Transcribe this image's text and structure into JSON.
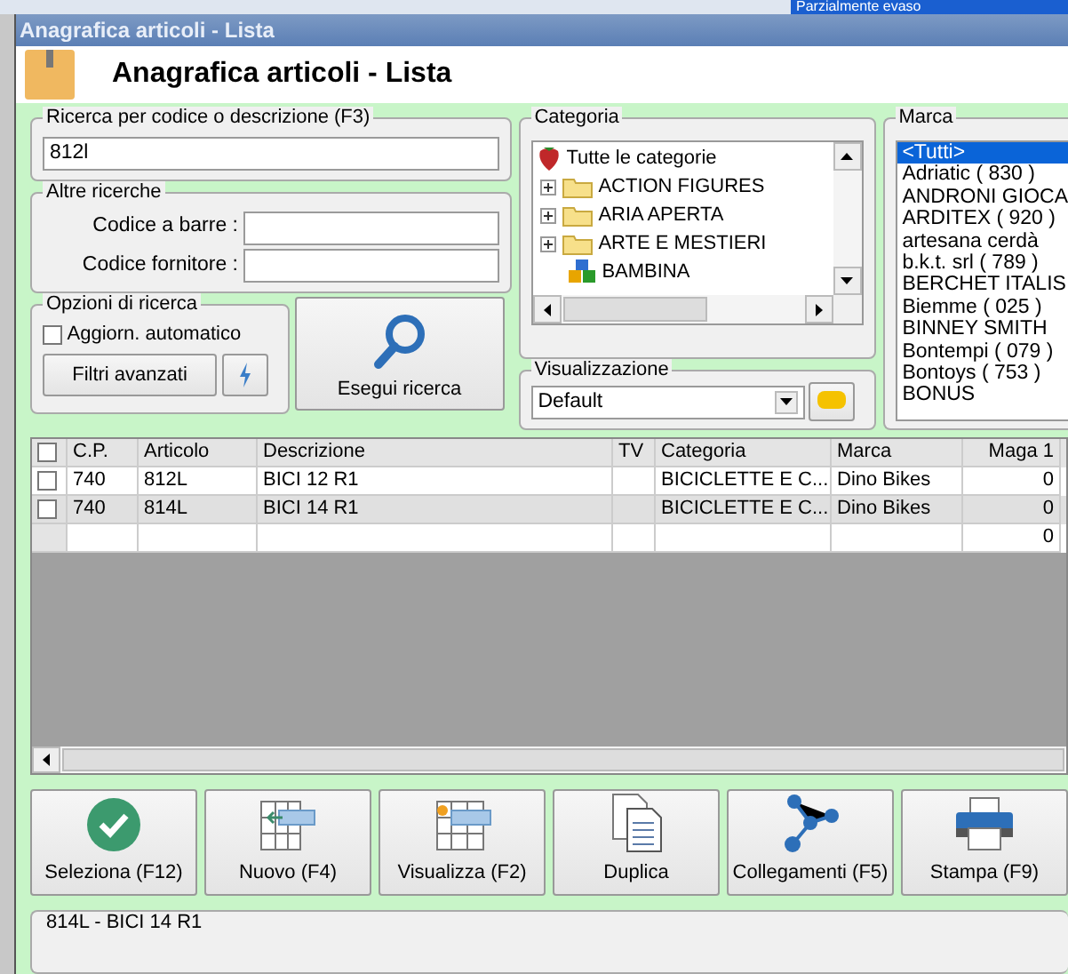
{
  "background_window": {
    "status_text": "Parzialmente evaso"
  },
  "window": {
    "title": "Anagrafica articoli  - Lista",
    "heading": "Anagrafica articoli  - Lista"
  },
  "search": {
    "label": "Ricerca per codice o descrizione (F3)",
    "value": "812l"
  },
  "other_searches": {
    "label": "Altre ricerche",
    "fields": [
      {
        "label": "Codice a barre :"
      },
      {
        "label": "Codice fornitore :"
      }
    ]
  },
  "options": {
    "label": "Opzioni di ricerca",
    "auto_update": {
      "label": "Aggiorn. automatico",
      "checked": false
    },
    "advanced_filters": "Filtri avanzati"
  },
  "search_button": "Esegui ricerca",
  "category": {
    "label": "Categoria",
    "items": [
      {
        "kind": "root",
        "label": "Tutte le categorie"
      },
      {
        "kind": "folder",
        "label": "ACTION FIGURES"
      },
      {
        "kind": "folder",
        "label": "ARIA APERTA"
      },
      {
        "kind": "folder",
        "label": "ARTE E MESTIERI"
      },
      {
        "kind": "blocks",
        "label": "BAMBINA"
      }
    ]
  },
  "view": {
    "label": "Visualizzazione",
    "value": "Default"
  },
  "brand": {
    "label": "Marca",
    "items": [
      {
        "label": "<Tutti>",
        "selected": true
      },
      {
        "label": "Adriatic ( 830 )",
        "selected": false
      },
      {
        "label": "ANDRONI GIOCA",
        "selected": false
      },
      {
        "label": "ARDITEX ( 920 )",
        "selected": false
      },
      {
        "label": "artesana cerdà",
        "selected": false
      },
      {
        "label": "b.k.t. srl ( 789 )",
        "selected": false
      },
      {
        "label": "BERCHET ITALIS",
        "selected": false
      },
      {
        "label": "Biemme ( 025 )",
        "selected": false
      },
      {
        "label": "BINNEY SMITH",
        "selected": false
      },
      {
        "label": "Bontempi ( 079 )",
        "selected": false
      },
      {
        "label": "Bontoys ( 753 )",
        "selected": false
      },
      {
        "label": "BONUS",
        "selected": false
      }
    ]
  },
  "table": {
    "select_all_checked": false,
    "columns": [
      "C.P.",
      "Articolo",
      "Descrizione",
      "TV",
      "Categoria",
      "Marca",
      "Maga 1"
    ],
    "rows": [
      {
        "checked": false,
        "selected": false,
        "cells": [
          "740",
          "812L",
          "BICI 12 R1",
          "",
          "BICICLETTE E C...",
          "Dino Bikes",
          "0"
        ]
      },
      {
        "checked": false,
        "selected": true,
        "cells": [
          "740",
          "814L",
          "BICI 14 R1",
          "",
          "BICICLETTE E C...",
          "Dino Bikes",
          "0"
        ]
      },
      {
        "kind": "new",
        "cells": [
          "",
          "",
          "",
          "",
          "",
          "",
          "0"
        ]
      }
    ]
  },
  "toolbar": [
    {
      "kind": "check",
      "label": "Seleziona (F12)"
    },
    {
      "kind": "new",
      "label": "Nuovo (F4)"
    },
    {
      "kind": "view",
      "label": "Visualizza (F2)"
    },
    {
      "kind": "copy",
      "label": "Duplica"
    },
    {
      "kind": "links",
      "label": "Collegamenti (F5)"
    },
    {
      "kind": "print",
      "label": "Stampa (F9)"
    }
  ],
  "status_bar": "814L - BICI 14 R1"
}
